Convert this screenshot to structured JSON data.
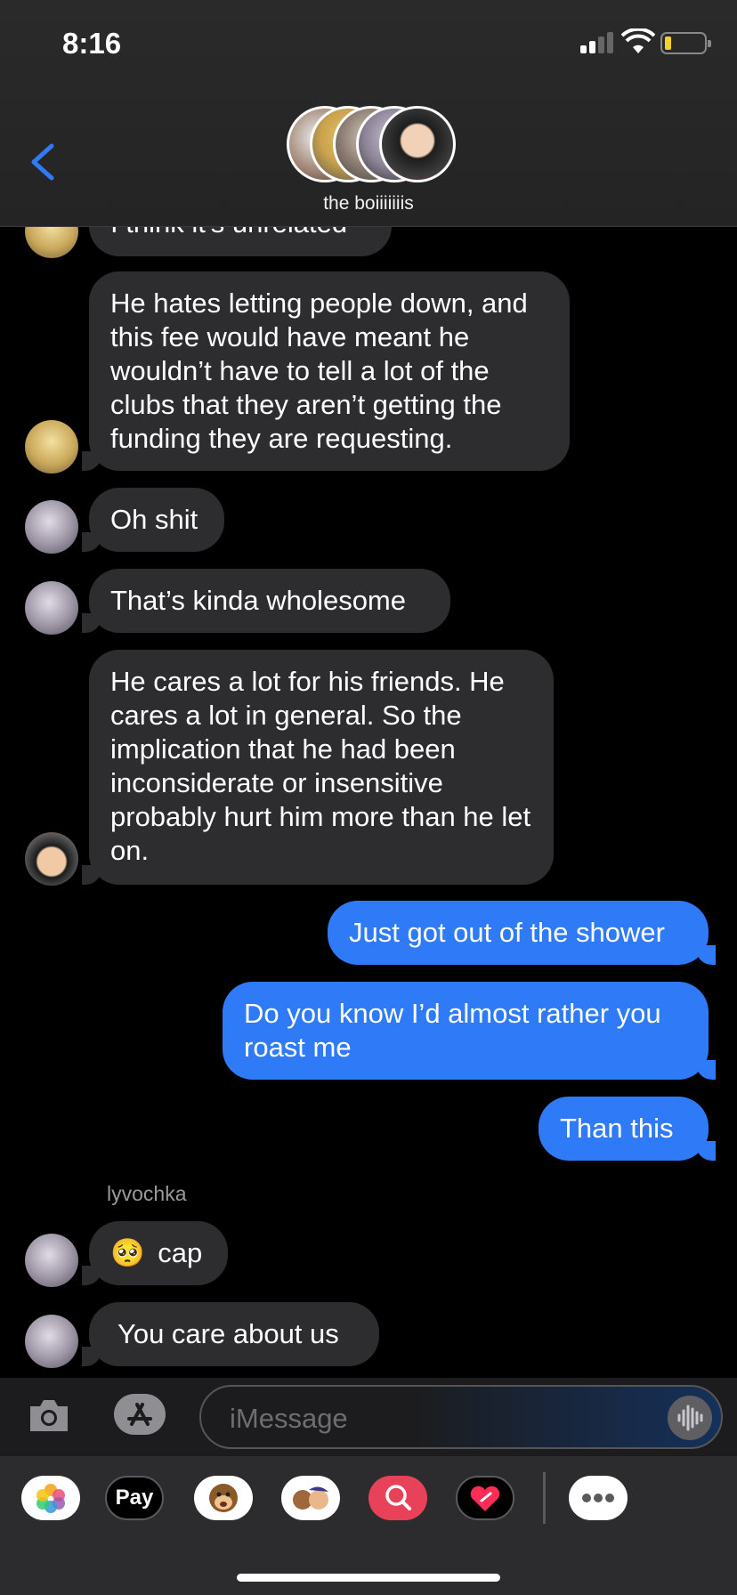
{
  "status_bar": {
    "time": "8:16"
  },
  "header": {
    "group_name": "the boiiiiiiis"
  },
  "messages": [
    {
      "text": "I think it's unrelated"
    },
    {
      "text": "He hates letting people down, and this fee would have meant he wouldn’t have to tell a lot of the clubs that they aren’t getting the funding they are requesting."
    },
    {
      "text": "Oh shit"
    },
    {
      "text": "That’s kinda wholesome"
    },
    {
      "text": "He cares a lot for his friends. He cares a lot in general. So the implication that he had been inconsiderate or insensitive probably hurt him more than he let on."
    },
    {
      "text": "Just got out of the shower"
    },
    {
      "text": "Do you know I’d almost rather you roast me"
    },
    {
      "text": "Than this"
    },
    {
      "sender": "lyvochka",
      "emoji": "🥺",
      "text": "cap"
    },
    {
      "text": "You care about us"
    }
  ],
  "input": {
    "placeholder": "iMessage"
  },
  "apps": [
    {
      "icon": "photos-icon"
    },
    {
      "icon": "apple-pay-icon",
      "label": "Pay"
    },
    {
      "icon": "animoji-icon"
    },
    {
      "icon": "memoji-icon"
    },
    {
      "icon": "image-search-icon"
    },
    {
      "icon": "digital-touch-icon"
    },
    {
      "icon": "more-apps-icon"
    }
  ],
  "colors": {
    "outgoing": "#2f7af6",
    "incoming": "#2d2d2f",
    "accent": "#2f7af6"
  }
}
